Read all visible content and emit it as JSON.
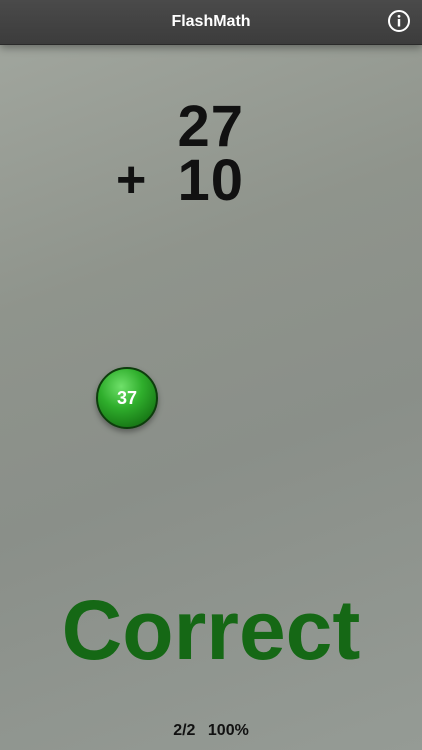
{
  "app": {
    "title": "FlashMath"
  },
  "nav": {
    "info_icon": "info-icon"
  },
  "problem": {
    "top_operand": "27",
    "operator": "+",
    "bottom_operand": "10"
  },
  "answer": {
    "value": "37",
    "color": "#2fae2c"
  },
  "result": {
    "text": "Correct",
    "color": "#156815"
  },
  "score": {
    "progress": "2/2",
    "percent": "100%"
  }
}
